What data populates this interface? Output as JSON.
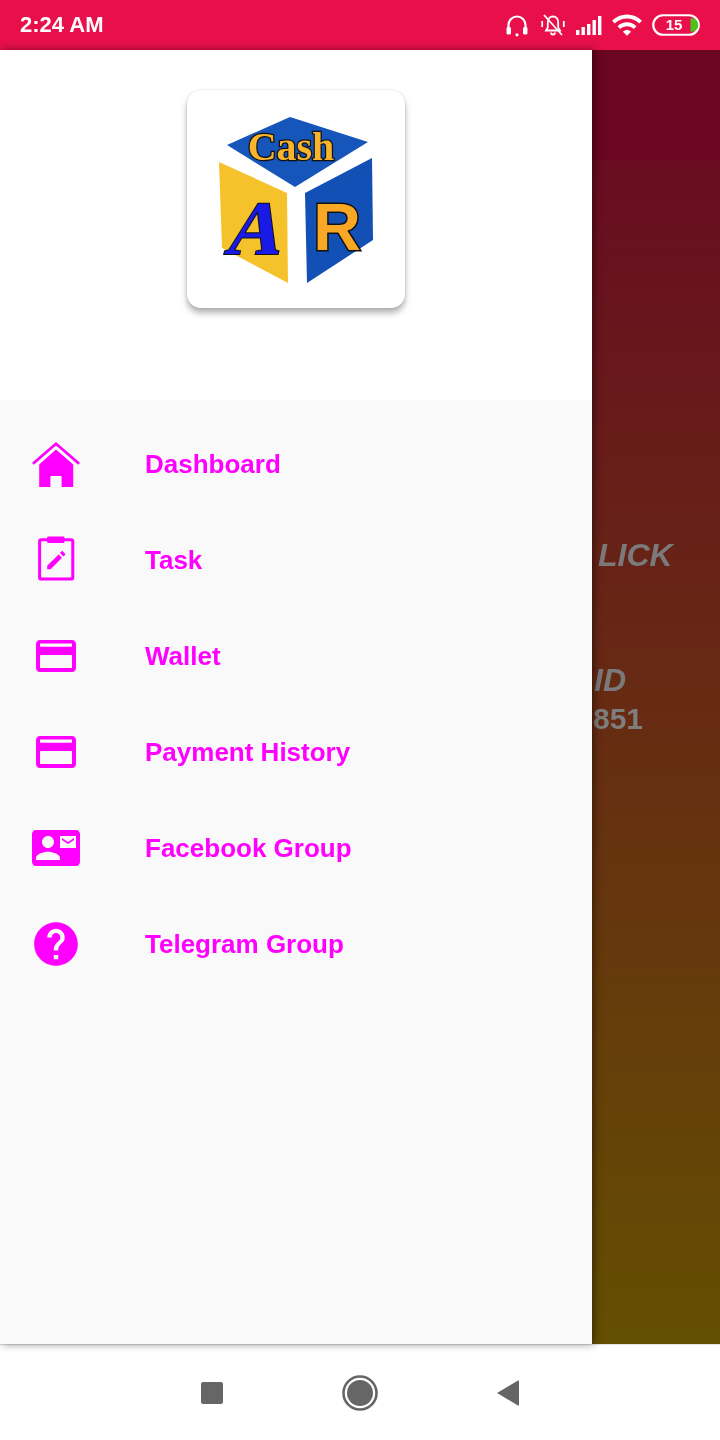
{
  "status_bar": {
    "time": "2:24 AM",
    "battery": "15"
  },
  "drawer": {
    "logo": {
      "top_text": "Cash",
      "left_letter": "A",
      "right_letter": "R"
    },
    "items": [
      {
        "kind": "home",
        "label": "Dashboard"
      },
      {
        "kind": "task",
        "label": "Task"
      },
      {
        "kind": "card",
        "label": "Wallet"
      },
      {
        "kind": "card",
        "label": "Payment History"
      },
      {
        "kind": "contact",
        "label": "Facebook Group"
      },
      {
        "kind": "help",
        "label": "Telegram Group"
      }
    ]
  },
  "background_screen": {
    "heading": "LICK",
    "label": "ID",
    "number": "851"
  }
}
